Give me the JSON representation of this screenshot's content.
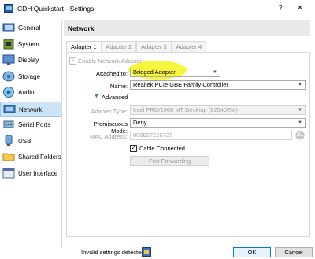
{
  "window": {
    "title": "CDH Quickstart - Settings",
    "help": "?",
    "close": "✕"
  },
  "sidebar": {
    "items": [
      {
        "label": "General",
        "icon": "general-icon"
      },
      {
        "label": "System",
        "icon": "system-icon"
      },
      {
        "label": "Display",
        "icon": "display-icon"
      },
      {
        "label": "Storage",
        "icon": "storage-icon"
      },
      {
        "label": "Audio",
        "icon": "audio-icon"
      },
      {
        "label": "Network",
        "icon": "network-icon"
      },
      {
        "label": "Serial Ports",
        "icon": "serial-ports-icon"
      },
      {
        "label": "USB",
        "icon": "usb-icon"
      },
      {
        "label": "Shared Folders",
        "icon": "shared-folders-icon"
      },
      {
        "label": "User Interface",
        "icon": "user-interface-icon"
      }
    ],
    "selected": "Network"
  },
  "header": {
    "title": "Network"
  },
  "tabs": [
    "Adapter 1",
    "Adapter 2",
    "Adapter 3",
    "Adapter 4"
  ],
  "form": {
    "enable_label": "Enable Network Adapter",
    "attached_label": "Attached to:",
    "attached_value": "Bridged Adapter",
    "name_label": "Name:",
    "name_value": "Realtek PCIe GBE Family Controller",
    "advanced_label": "Advanced",
    "adapter_type_label": "Adapter Type:",
    "adapter_type_value": "Intel PRO/1000 MT Desktop (82540EM)",
    "promiscuous_label": "Promiscuous Mode:",
    "promiscuous_value": "Deny",
    "mac_label": "MAC Address:",
    "mac_value": "080027226737",
    "cable_label": "Cable Connected",
    "port_forwarding_label": "Port Forwarding"
  },
  "footer": {
    "status": "Invalid settings detected",
    "ok": "OK",
    "cancel": "Cancel"
  },
  "colors": {
    "selection": "#cce4f7",
    "highlight": "#f6f52a"
  }
}
